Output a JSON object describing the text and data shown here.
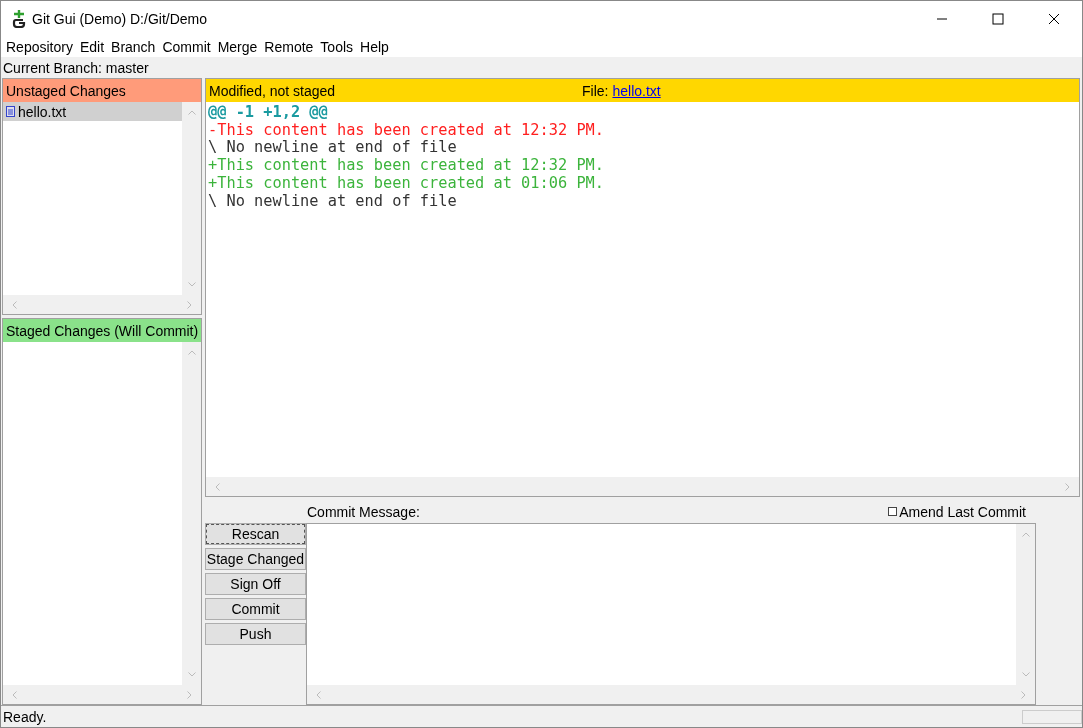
{
  "window": {
    "title": "Git Gui (Demo) D:/Git/Demo"
  },
  "menu": [
    "Repository",
    "Edit",
    "Branch",
    "Commit",
    "Merge",
    "Remote",
    "Tools",
    "Help"
  ],
  "branch": {
    "label": "Current Branch:",
    "name": "master"
  },
  "unstaged": {
    "title": "Unstaged Changes",
    "files": [
      {
        "name": "hello.txt",
        "selected": true
      }
    ]
  },
  "staged": {
    "title": "Staged Changes (Will Commit)"
  },
  "diff": {
    "status": "Modified, not staged",
    "file_label": "File:",
    "file": "hello.txt",
    "lines": [
      {
        "kind": "hunk",
        "text": "@@ -1 +1,2 @@"
      },
      {
        "kind": "del",
        "text": "-This content has been created at 12:32 PM."
      },
      {
        "kind": "ctx",
        "text": "\\ No newline at end of file"
      },
      {
        "kind": "add",
        "text": "+This content has been created at 12:32 PM."
      },
      {
        "kind": "add",
        "text": "+This content has been created at 01:06 PM."
      },
      {
        "kind": "ctx",
        "text": "\\ No newline at end of file"
      }
    ]
  },
  "commit": {
    "label": "Commit Message:",
    "amend": {
      "label": "Amend Last Commit",
      "checked": false
    },
    "buttons": [
      "Rescan",
      "Stage Changed",
      "Sign Off",
      "Commit",
      "Push"
    ]
  },
  "status_bar": "Ready."
}
